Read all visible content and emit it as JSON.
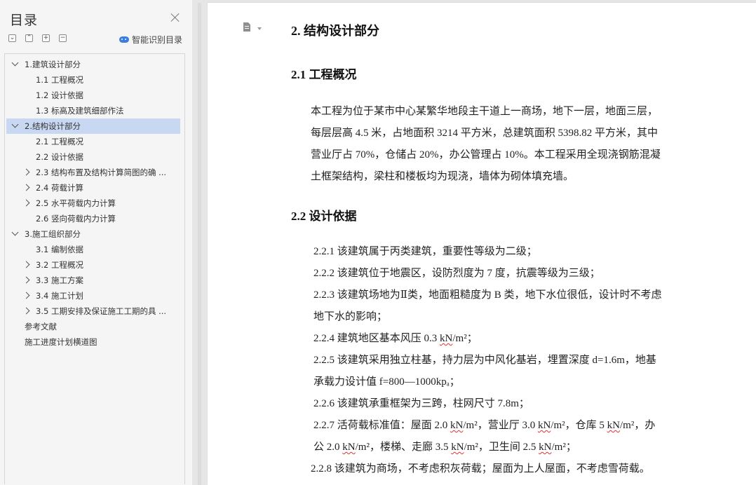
{
  "toc": {
    "title": "目录",
    "controls": [
      "⌄",
      "⌃",
      "+",
      "−"
    ],
    "smart_label": "智能识别目录",
    "items": [
      {
        "label": "1.建筑设计部分",
        "level": 0,
        "chevron": "down"
      },
      {
        "label": "1.1 工程概况",
        "level": 1
      },
      {
        "label": "1.2 设计依据",
        "level": 1
      },
      {
        "label": "1.3 标高及建筑细部作法",
        "level": 1
      },
      {
        "label": "2.结构设计部分",
        "level": 0,
        "chevron": "down",
        "selected": true
      },
      {
        "label": "2.1 工程概况",
        "level": 1
      },
      {
        "label": "2.2 设计依据",
        "level": 1
      },
      {
        "label": "2.3 结构布置及结构计算简图的确 ...",
        "level": 1,
        "chevron": "right"
      },
      {
        "label": "2.4 荷载计算",
        "level": 1,
        "chevron": "right"
      },
      {
        "label": "2.5 水平荷载内力计算",
        "level": 1,
        "chevron": "right"
      },
      {
        "label": "2.6 竖向荷载内力计算",
        "level": 1
      },
      {
        "label": "3.施工组织部分",
        "level": 0,
        "chevron": "down"
      },
      {
        "label": "3.1 编制依据",
        "level": 1
      },
      {
        "label": "3.2 工程概况",
        "level": 1,
        "chevron": "right"
      },
      {
        "label": "3.3 施工方案",
        "level": 1,
        "chevron": "right"
      },
      {
        "label": "3.4 施工计划",
        "level": 1,
        "chevron": "right"
      },
      {
        "label": "3.5 工期安排及保证施工工期的具 ...",
        "level": 1,
        "chevron": "right"
      },
      {
        "label": "参考文献",
        "level": 0
      },
      {
        "label": "施工进度计划横道图",
        "level": 0
      }
    ]
  },
  "doc": {
    "h_2": "2. 结构设计部分",
    "h_2_1": "2.1 工程概况",
    "intro": [
      "本工程为位于某市中心某繁华地段主干道上一商场，地下一层，地面三层，",
      "每层层高 4.5 米，占地面积 3214 平方米，总建筑面积 5398.82 平方米，其中",
      "营业厅占 70%，仓储占 20%，办公管理占 10%。本工程采用全现浇钢筋混凝",
      "土框架结构，梁柱和楼板均为现浇，墙体为砌体填充墙。"
    ],
    "h_2_2": "2.2 设计依据",
    "basis": {
      "l1": "2.2.1 该建筑属于丙类建筑，重要性等级为二级；",
      "l2": "2.2.2 该建筑位于地震区，设防烈度为 7 度，抗震等级为三级；",
      "l3": "2.2.3 该建筑场地为Ⅱ类，地面粗糙度为 B 类，地下水位很低，设计时不考虑",
      "l3b": "地下水的影响；",
      "l4a": "2.2.4 建筑地区基本风压  0.3 ",
      "l4u": "kN",
      "l4b": "/m²；",
      "l5": "2.2.5 该建筑采用独立柱基，持力层为中风化基岩，埋置深度 d=1.6m，地基",
      "l5b": "承载力设计值 f=800—1000kpₐ；",
      "l6": "2.2.6 该建筑承重框架为三跨，柱网尺寸 7.8m；",
      "l7a": "2.2.7 活荷载标准值：屋面 2.0 ",
      "l7u1": "kN",
      "l7b": "/m²，营业厅 3.0 ",
      "l7u2": "kN",
      "l7c": "/m²，仓库 5 ",
      "l7u3": "kN",
      "l7d": "/m²，办",
      "l7e": "公 2.0 ",
      "l7u4": "kN",
      "l7f": "/m²，楼梯、走廊 3.5 ",
      "l7u5": "kN",
      "l7g": "/m²，卫生间 2.5 ",
      "l7u6": "kN",
      "l7h": "/m²；",
      "l8": "2.2.8 该建筑为商场，不考虑积灰荷载；屋面为上人屋面，不考虑雪荷载。"
    }
  }
}
